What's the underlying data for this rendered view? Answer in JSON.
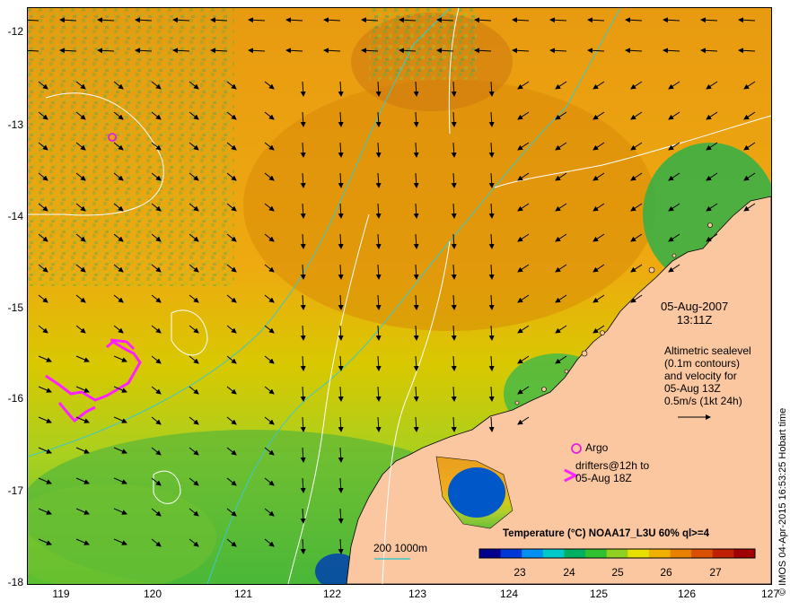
{
  "map": {
    "lat_labels": [
      "-12",
      "-13",
      "-14",
      "-15",
      "-16",
      "-17",
      "-18"
    ],
    "lon_labels": [
      "119",
      "120",
      "121",
      "122",
      "123",
      "124",
      "125",
      "126",
      "127"
    ],
    "land_color": "#fac7a0",
    "contour_color": "#ffffff",
    "bathy_color": "#3cc8c8",
    "argo_color": "#e020e0",
    "drifter_color": "#ff20ff"
  },
  "annotation": {
    "date": "05-Aug-2007",
    "time": "13:11Z",
    "altimetry_lines": [
      "Altimetric sealevel",
      "(0.1m contours)",
      "and velocity for",
      "05-Aug 13Z",
      "0.5m/s (1kt 24h)"
    ]
  },
  "legend": {
    "argo_label": "Argo",
    "drifter_lines": [
      "drifters@12h to",
      "05-Aug 18Z"
    ],
    "scale_label": "200  1000m"
  },
  "colorbar": {
    "title": "Temperature (°C) NOAA17_L3U 60% ql>=4",
    "ticks": [
      "23",
      "24",
      "25",
      "26",
      "27"
    ],
    "colors": [
      "#00008c",
      "#0038d8",
      "#0090f0",
      "#00c8c8",
      "#00b060",
      "#30c030",
      "#90d020",
      "#e8e000",
      "#f0b000",
      "#e88000",
      "#d85000",
      "#c02000",
      "#a00000"
    ]
  },
  "credit": "© IMOS 04-Apr-2015 16:53:25 Hobart time"
}
